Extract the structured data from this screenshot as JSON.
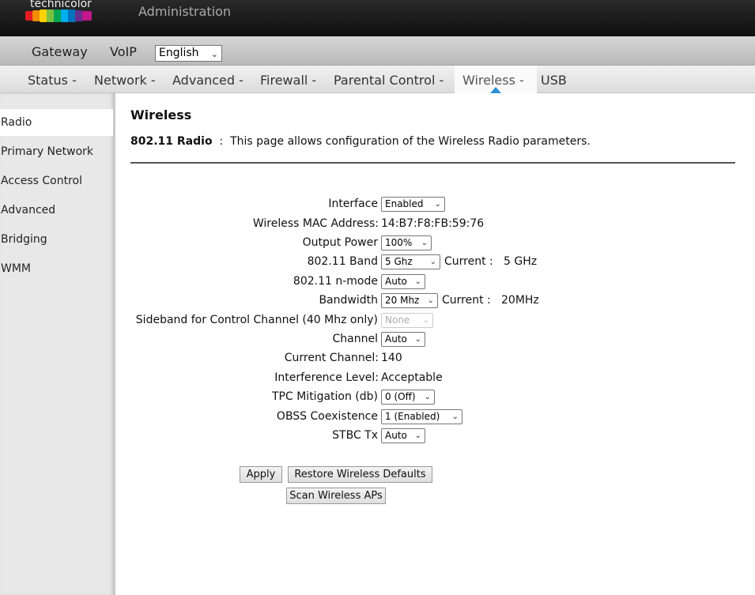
{
  "header": {
    "brand": "technicolor",
    "title": "Administration"
  },
  "nav_primary": {
    "items": [
      "Gateway",
      "VoIP"
    ],
    "language": {
      "selected": "English"
    }
  },
  "nav_secondary": {
    "items": [
      "Status -",
      "Network -",
      "Advanced -",
      "Firewall -",
      "Parental Control -",
      "Wireless -",
      "USB"
    ],
    "active": "Wireless -"
  },
  "sidebar": {
    "items": [
      "Radio",
      "Primary Network",
      "Access Control",
      "Advanced",
      "Bridging",
      "WMM"
    ],
    "active": "Radio"
  },
  "main": {
    "title": "Wireless",
    "desc_label": "802.11 Radio",
    "desc_sep": ":",
    "desc_text": "This page allows configuration of the Wireless Radio parameters.",
    "fields": {
      "interface": {
        "label": "Interface",
        "value": "Enabled"
      },
      "mac": {
        "label": "Wireless MAC Address:",
        "value": "14:B7:F8:FB:59:76"
      },
      "output_power": {
        "label": "Output Power",
        "value": "100%"
      },
      "band": {
        "label": "802.11 Band",
        "value": "5 Ghz",
        "current_label": "Current :",
        "current_value": "5 GHz"
      },
      "nmode": {
        "label": "802.11 n-mode",
        "value": "Auto"
      },
      "bandwidth": {
        "label": "Bandwidth",
        "value": "20 Mhz",
        "current_label": "Current :",
        "current_value": "20MHz"
      },
      "sideband": {
        "label": "Sideband for Control Channel (40 Mhz only)",
        "value": "None"
      },
      "channel": {
        "label": "Channel",
        "value": "Auto"
      },
      "current_channel": {
        "label": "Current Channel:",
        "value": "140"
      },
      "interference": {
        "label": "Interference Level:",
        "value": "Acceptable"
      },
      "tpc": {
        "label": "TPC Mitigation (db)",
        "value": "0 (Off)"
      },
      "obss": {
        "label": "OBSS Coexistence",
        "value": "1 (Enabled)"
      },
      "stbc": {
        "label": "STBC Tx",
        "value": "Auto"
      }
    },
    "buttons": {
      "apply": "Apply",
      "restore": "Restore Wireless Defaults",
      "scan": "Scan Wireless APs"
    }
  },
  "colors": {
    "active_arrow": "#2c8fd6"
  }
}
